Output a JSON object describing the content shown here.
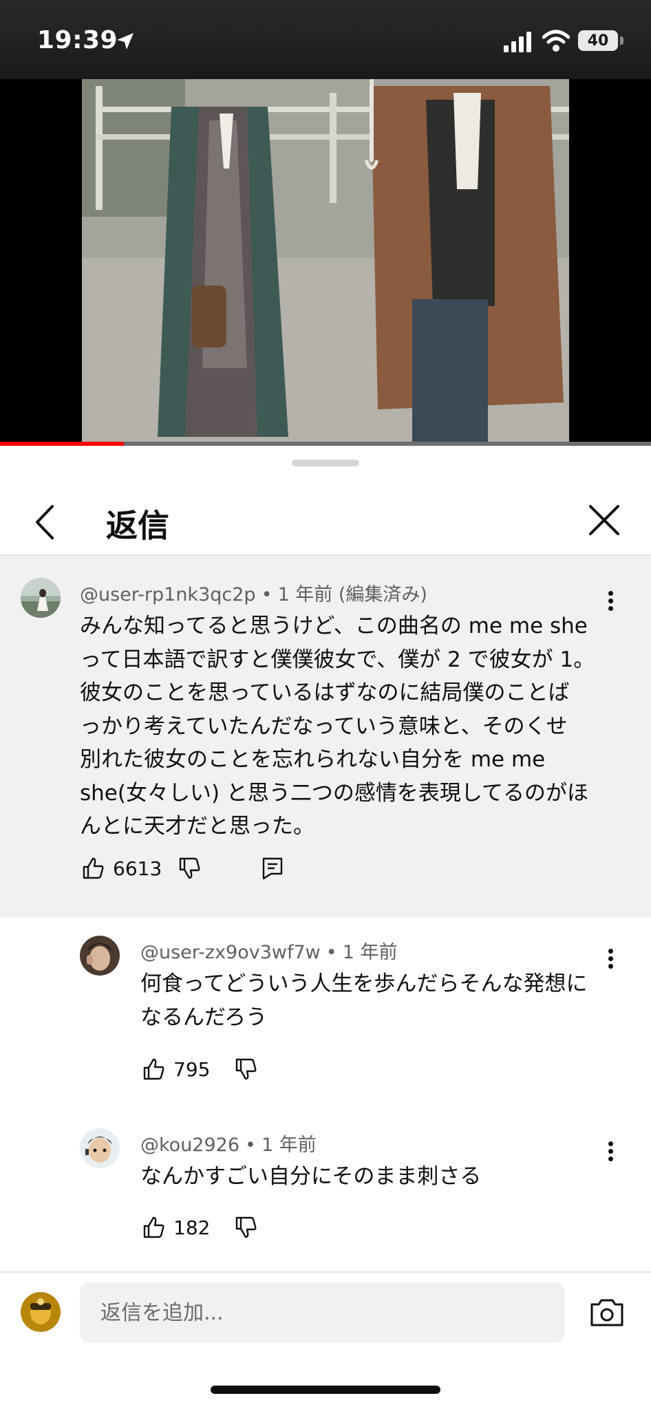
{
  "status_bar": {
    "time": "19:39",
    "battery": "40",
    "icons": [
      "location-arrow-icon",
      "cellular-signal-icon",
      "wifi-icon",
      "battery-icon"
    ]
  },
  "video": {
    "progress": 0.19,
    "progress_color": "#ff0000"
  },
  "header": {
    "title": "返信",
    "back_icon": "chevron-left-icon",
    "close_icon": "close-icon"
  },
  "parent_comment": {
    "author": "@user-rp1nk3qc2p",
    "separator": "•",
    "time": "1 年前",
    "edited": "(編集済み)",
    "lines": [
      "みんな知ってると思うけど、この曲名の me me she",
      "って日本語で訳すと僕僕彼女で、僕が 2 で彼女が 1。",
      "彼女のことを思っているはずなのに結局僕のことば",
      "っかり考えていたんだなっていう意味と、そのくせ",
      "別れた彼女のことを忘れられない自分を me me",
      "she(女々しい) と思う二つの感情を表現してるのがほ",
      "んとに天才だと思った。"
    ],
    "likes": "6613",
    "icons": [
      "thumbs-up-icon",
      "thumbs-down-icon",
      "reply-icon",
      "more-vertical-icon"
    ]
  },
  "replies": [
    {
      "author": "@user-zx9ov3wf7w",
      "separator": "•",
      "time": "1 年前",
      "lines": [
        "何食ってどういう人生を歩んだらそんな発想に",
        "なるんだろう"
      ],
      "likes": "795"
    },
    {
      "author": "@kou2926",
      "separator": "•",
      "time": "1 年前",
      "lines": [
        "なんかすごい自分にそのまま刺さる"
      ],
      "likes": "182"
    }
  ],
  "composer": {
    "placeholder": "返信を追加...",
    "camera_icon": "camera-icon"
  },
  "colors": {
    "sheet_bg": "#ffffff",
    "highlight_bg": "#f1f1f1",
    "meta_text": "#606060",
    "primary_text": "#0f0f0f"
  }
}
